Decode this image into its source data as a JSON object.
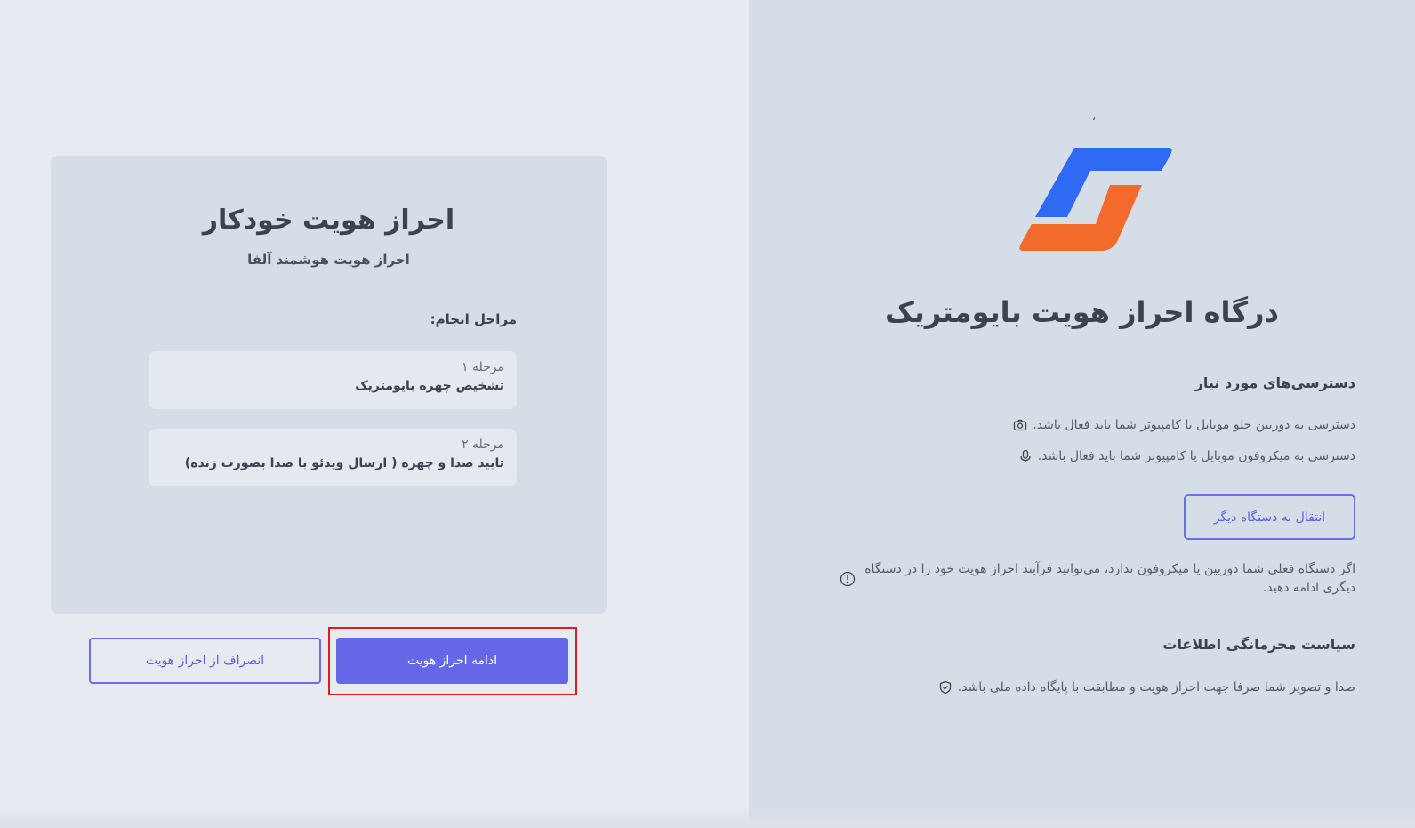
{
  "brand": {
    "logo_icon": "brand-logo-icon",
    "colors": {
      "blue": "#2f6bf2",
      "orange": "#f26a2c",
      "accent": "#6467e8"
    },
    "mark": "،"
  },
  "portal": {
    "title": "درگاه احراز هویت بایومتریک"
  },
  "requirements": {
    "heading": "دسترسی‌های مورد نیاز",
    "items": [
      {
        "icon": "camera-icon",
        "text": "دسترسی به دوربین جلو موبایل یا کامپیوتر شما باید فعال باشد."
      },
      {
        "icon": "microphone-icon",
        "text": "دسترسی به میکروفون موبایل یا کامپیوتر شما باید فعال باشد."
      }
    ],
    "transfer_button": "انتقال به دستگاه دیگر",
    "info_icon": "info-icon",
    "info_text": "اگر دستگاه فعلی شما دوربین یا میکروفون ندارد، می‌توانید فرآیند احراز هویت خود را در دستگاه دیگری ادامه دهید."
  },
  "privacy": {
    "heading": "سیاست محرمانگی اطلاعات",
    "icon": "shield-check-icon",
    "text": "صدا و تصویر شما صرفا جهت احراز هویت و مطابقت با پایگاه داده ملی باشد."
  },
  "card": {
    "title": "احراز هویت خودکار",
    "subtitle": "احراز هویت هوشمند آلفا",
    "steps_heading": "مراحل انجام:",
    "steps": [
      {
        "label": "مرحله ۱",
        "desc": "تشخیص چهره بایومتریک"
      },
      {
        "label": "مرحله ۲",
        "desc": "تایید صدا و چهره ( ارسال ویدئو با صدا بصورت زنده)"
      }
    ]
  },
  "actions": {
    "continue": "ادامه احراز هویت",
    "cancel": "انصراف از احراز هویت"
  }
}
